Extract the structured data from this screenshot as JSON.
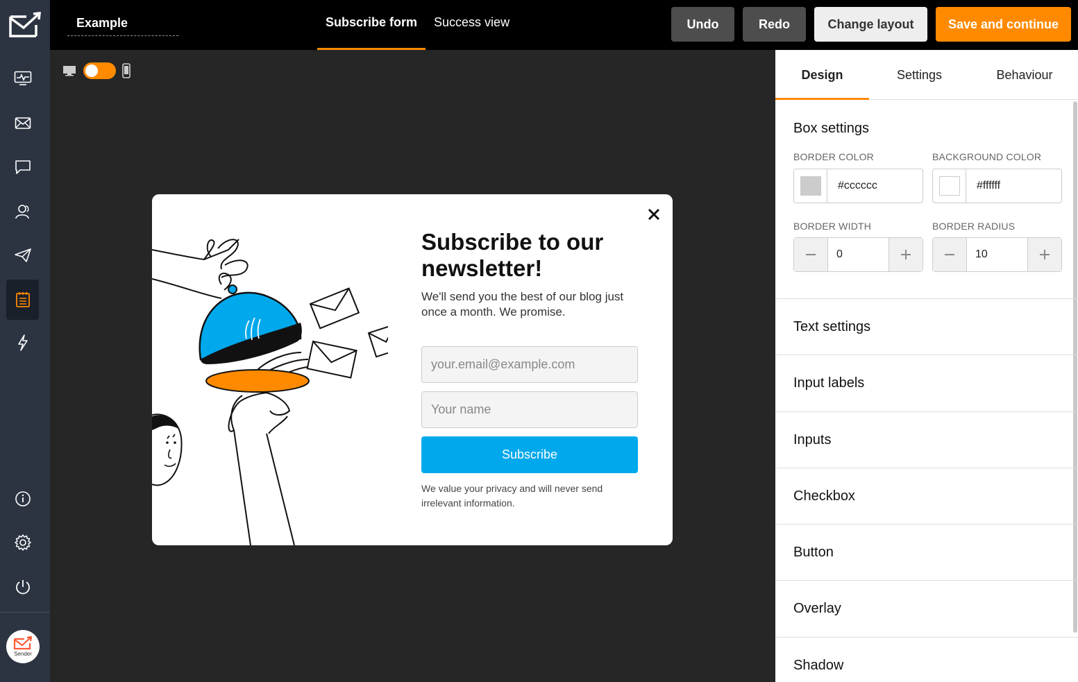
{
  "header": {
    "form_name": "Example",
    "tabs": [
      {
        "label": "Subscribe form",
        "active": true
      },
      {
        "label": "Success view",
        "active": false
      }
    ],
    "buttons": {
      "undo": "Undo",
      "redo": "Redo",
      "change_layout": "Change layout",
      "save": "Save and continue"
    }
  },
  "sidebar": {
    "items": [
      "dashboard-icon",
      "campaigns-icon",
      "chat-icon",
      "subscribers-icon",
      "send-icon",
      "forms-icon",
      "automation-icon"
    ],
    "active": "forms-icon",
    "bottom_items": [
      "info-icon",
      "gear-icon",
      "power-icon"
    ],
    "brand_label": "Sender"
  },
  "device_toggle": {
    "mode": "desktop"
  },
  "popup": {
    "title": "Subscribe to our newsletter!",
    "description": "We'll send you the best of our blog just once a month. We promise.",
    "email_placeholder": "your.email@example.com",
    "name_placeholder": "Your name",
    "subscribe_label": "Subscribe",
    "privacy_text": "We value your privacy and will never send irrelevant information."
  },
  "panel": {
    "tabs": [
      {
        "label": "Design",
        "active": true
      },
      {
        "label": "Settings",
        "active": false
      },
      {
        "label": "Behaviour",
        "active": false
      }
    ],
    "box_settings": {
      "title": "Box settings",
      "border_color_label": "BORDER COLOR",
      "border_color": "#cccccc",
      "background_color_label": "BACKGROUND COLOR",
      "background_color": "#ffffff",
      "border_width_label": "BORDER WIDTH",
      "border_width": "0",
      "border_radius_label": "BORDER RADIUS",
      "border_radius": "10"
    },
    "sections": [
      "Text settings",
      "Input labels",
      "Inputs",
      "Checkbox",
      "Button",
      "Overlay",
      "Shadow"
    ]
  },
  "colors": {
    "accent": "#ff8a00",
    "subscribe": "#00a8ec",
    "sidebar": "#2c3442"
  }
}
